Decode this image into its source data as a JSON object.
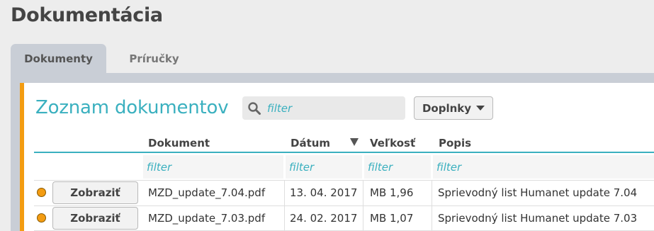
{
  "page": {
    "title": "Dokumentácia"
  },
  "tabs": [
    {
      "label": "Dokumenty",
      "active": true
    },
    {
      "label": "Príručky",
      "active": false
    }
  ],
  "panel": {
    "title": "Zoznam dokumentov",
    "search_placeholder": "filter",
    "addons_label": "Doplnky"
  },
  "table": {
    "columns": [
      {
        "label": "Dokument"
      },
      {
        "label": "Dátum",
        "sorted": "descending"
      },
      {
        "label": "Veľkosť"
      },
      {
        "label": "Popis"
      }
    ],
    "filter_placeholder": "filter",
    "rows": [
      {
        "action": "Zobraziť",
        "document": "MZD_update_7.04.pdf",
        "date": "13. 04. 2017",
        "size": "MB 1,96",
        "description": "Sprievodný list Humanet update 7.04"
      },
      {
        "action": "Zobraziť",
        "document": "MZD_update_7.03.pdf",
        "date": "24. 02. 2017",
        "size": "MB 1,07",
        "description": "Sprievodný list Humanet update 7.03"
      }
    ]
  },
  "colors": {
    "accent": "#3ab0bf",
    "status": "#f39c12",
    "tab_bg": "#c9ced6"
  },
  "icons": {
    "search": "search-icon",
    "sort": "sort-desc-icon",
    "status": "status-dot"
  }
}
